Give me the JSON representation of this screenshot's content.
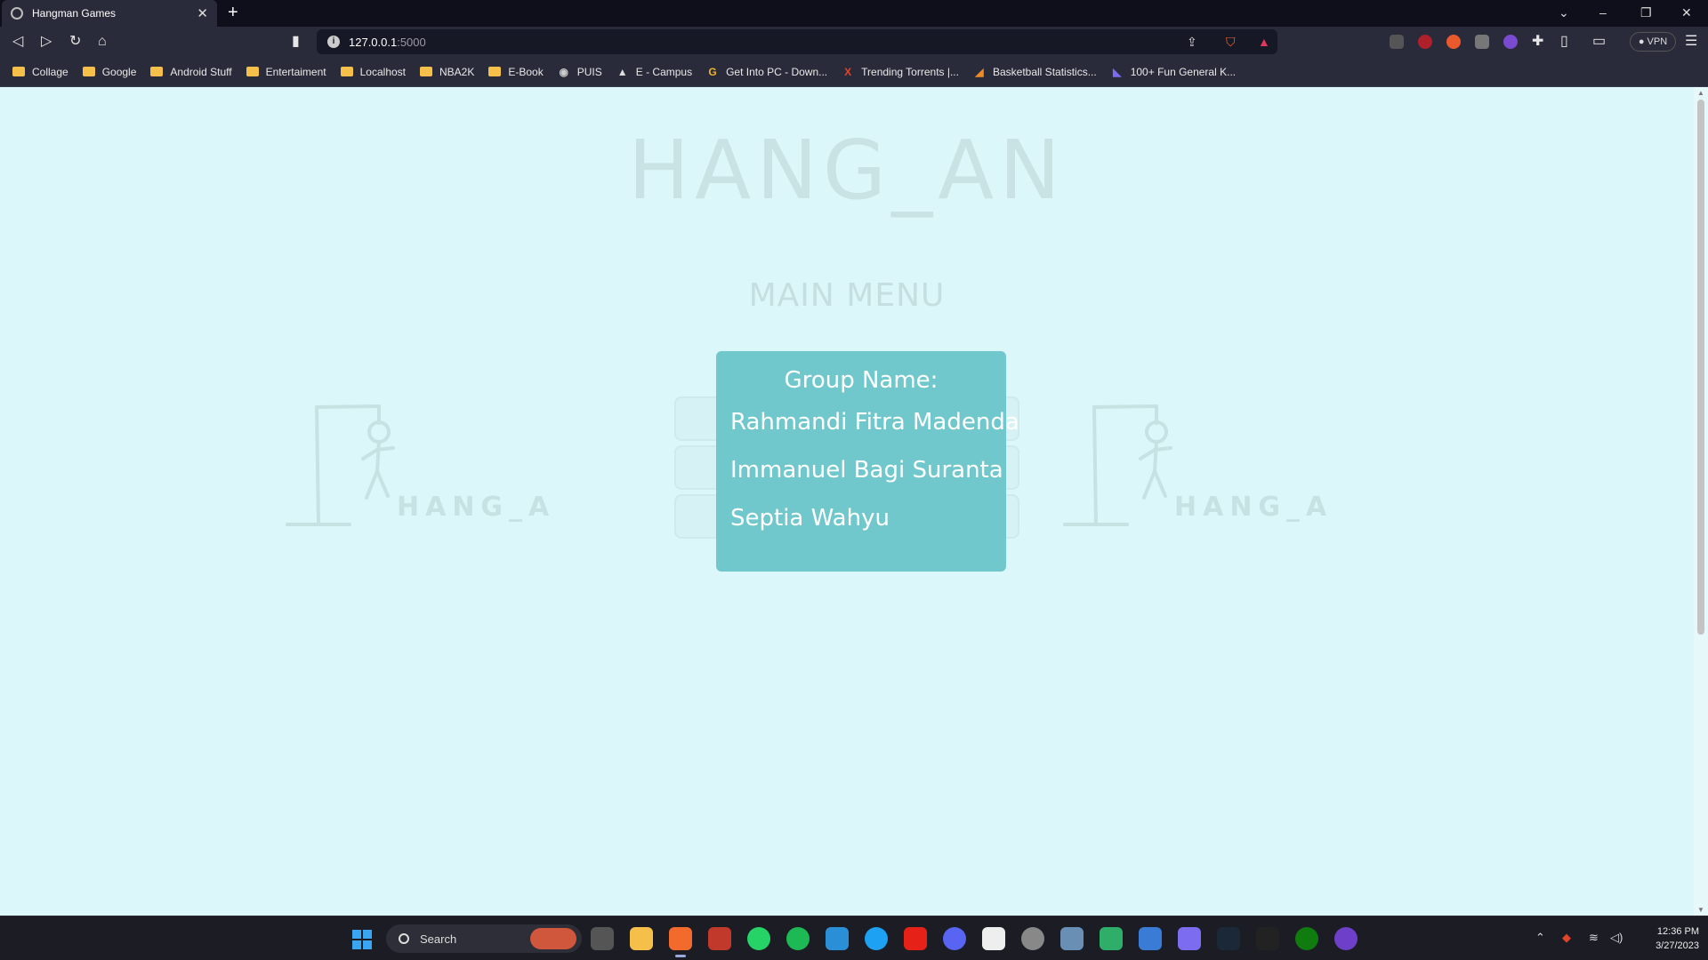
{
  "browser": {
    "tab_title": "Hangman Games",
    "tab_close": "✕",
    "new_tab": "+",
    "url_host": "127.0.0.1",
    "url_port": ":5000",
    "vpn_label": "● VPN",
    "bookmarks": [
      "Collage",
      "Google",
      "Android Stuff",
      "Entertaiment",
      "Localhost",
      "NBA2K",
      "E-Book",
      "PUIS",
      "E - Campus",
      "Get Into PC - Down...",
      "Trending Torrents |...",
      "Basketball Statistics...",
      "100+ Fun General K..."
    ]
  },
  "page": {
    "game_title": "HANG_AN",
    "menu_title": "MAIN MENU",
    "logo_text": "HANG_AN",
    "group_card": {
      "heading": "Group Name:",
      "members": [
        "Rahmandi Fitra Madenda",
        "Immanuel Bagi Suranta",
        "Septia Wahyu"
      ]
    }
  },
  "taskbar": {
    "search_label": "Search",
    "time": "12:36 PM",
    "date": "3/27/2023"
  },
  "colors": {
    "page_bg": "#dbf7f9",
    "card_bg": "#71c8cc",
    "title_faded": "#c9e2e3"
  }
}
